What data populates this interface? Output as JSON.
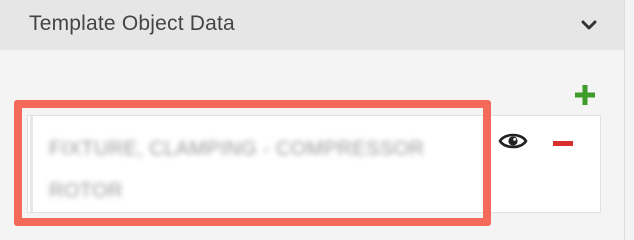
{
  "panel": {
    "title": "Template Object Data",
    "toggle_icon": "chevron-down-icon"
  },
  "rows": [
    {
      "value": "FIXTURE, CLAMPING - COMPRESSOR ROTOR",
      "view_icon": "eye-icon",
      "remove_icon": "minus-icon"
    }
  ],
  "actions": {
    "add_icon": "plus-icon"
  },
  "colors": {
    "add": "#3f9b2a",
    "remove": "#d9302f",
    "highlight": "#f36a5a",
    "header_bg": "#e6e6e6",
    "body_bg": "#f4f4f4"
  }
}
